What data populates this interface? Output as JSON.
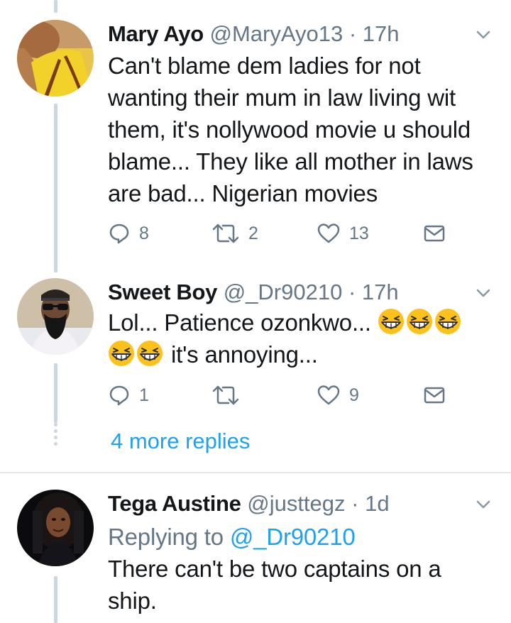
{
  "tweets": [
    {
      "name": "Mary Ayo",
      "handle": "@MaryAyo13",
      "separator": "·",
      "time": "17h",
      "text": "Can't blame dem ladies for not wanting their mum in law living wit them, it's nollywood movie u should blame... They like all mother in laws are bad... Nigerian movies",
      "replies": "8",
      "retweets": "2",
      "likes": "13"
    },
    {
      "name": "Sweet Boy",
      "handle": "@_Dr90210",
      "separator": "·",
      "time": "17h",
      "text_line1": "Lol...  Patience ozonkwo...",
      "text_line2": "it's annoying...",
      "emoji_name": "grinning-squinting-face",
      "replies": "1",
      "retweets": "",
      "likes": "9"
    },
    {
      "name": "Tega Austine",
      "handle": "@justtegz",
      "separator": "·",
      "time": "1d",
      "replying_label": "Replying to",
      "replying_to": "@_Dr90210",
      "text": "There can't be two captains on a ship."
    }
  ],
  "more_replies": "4 more replies",
  "icons": {
    "reply": "reply-icon",
    "retweet": "retweet-icon",
    "like": "heart-icon",
    "dm": "envelope-icon",
    "menu": "chevron-down-icon"
  },
  "colors": {
    "accent": "#1da1f2",
    "muted": "#657786",
    "text": "#14171a",
    "thread_line": "#ccd6dd"
  }
}
